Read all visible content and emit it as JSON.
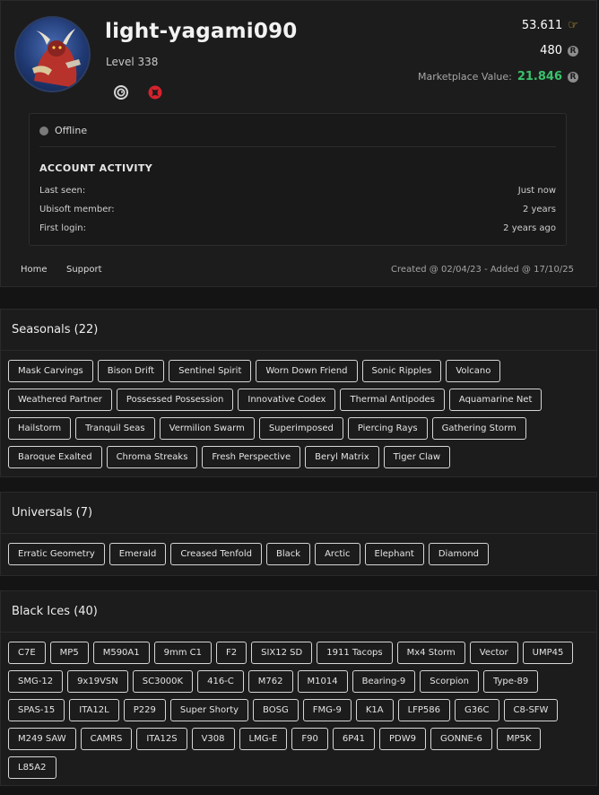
{
  "profile": {
    "username": "light-yagami090",
    "level": "Level 338",
    "platforms": [
      "ubisoft-icon",
      "xbox-icon"
    ],
    "credits": "53.611",
    "renown": "480",
    "marketplace_label": "Marketplace Value:",
    "marketplace_value": "21.846",
    "colors": {
      "marketplace_value": "#38c26b",
      "xbox": "#d6232c",
      "credits_icon": "#e2b33a"
    }
  },
  "activity": {
    "status": "Offline",
    "title": "ACCOUNT ACTIVITY",
    "rows": [
      {
        "label": "Last seen:",
        "value": "Just now"
      },
      {
        "label": "Ubisoft member:",
        "value": "2 years"
      },
      {
        "label": "First login:",
        "value": "2 years ago"
      }
    ]
  },
  "nav": {
    "home": "Home",
    "support": "Support"
  },
  "meta": "Created @ 02/04/23 - Added @ 17/10/25",
  "seasonals": {
    "title": "Seasonals (22)",
    "items": [
      "Mask Carvings",
      "Bison Drift",
      "Sentinel Spirit",
      "Worn Down Friend",
      "Sonic Ripples",
      "Volcano",
      "Weathered Partner",
      "Possessed Possession",
      "Innovative Codex",
      "Thermal Antipodes",
      "Aquamarine Net",
      "Hailstorm",
      "Tranquil Seas",
      "Vermilion Swarm",
      "Superimposed",
      "Piercing Rays",
      "Gathering Storm",
      "Baroque Exalted",
      "Chroma Streaks",
      "Fresh Perspective",
      "Beryl Matrix",
      "Tiger Claw"
    ]
  },
  "universals": {
    "title": "Universals (7)",
    "items": [
      "Erratic Geometry",
      "Emerald",
      "Creased Tenfold",
      "Black",
      "Arctic",
      "Elephant",
      "Diamond"
    ]
  },
  "black_ices": {
    "title": "Black Ices (40)",
    "items": [
      "C7E",
      "MP5",
      "M590A1",
      "9mm C1",
      "F2",
      "SIX12 SD",
      "1911 Tacops",
      "Mx4 Storm",
      "Vector",
      "UMP45",
      "SMG-12",
      "9x19VSN",
      "SC3000K",
      "416-C",
      "M762",
      "M1014",
      "Bearing-9",
      "Scorpion",
      "Type-89",
      "SPAS-15",
      "ITA12L",
      "P229",
      "Super Shorty",
      "BOSG",
      "FMG-9",
      "K1A",
      "LFP586",
      "G36C",
      "C8-SFW",
      "M249 SAW",
      "CAMRS",
      "ITA12S",
      "V308",
      "LMG-E",
      "F90",
      "6P41",
      "PDW9",
      "GONNE-6",
      "MP5K",
      "L85A2"
    ]
  }
}
